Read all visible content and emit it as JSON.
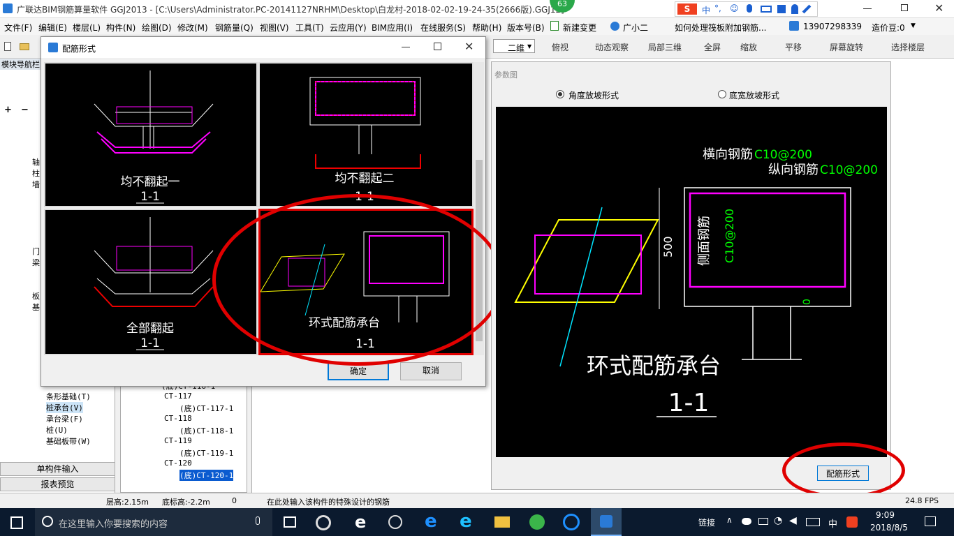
{
  "app": {
    "title": "广联达BIM钢筋算量软件 GGJ2013 - [C:\\Users\\Administrator.PC-20141127NRHM\\Desktop\\白龙村-2018-02-02-19-24-35(2666版).GGJ12]",
    "badge": "63"
  },
  "ime_bar": [
    "中",
    "°,",
    "☺",
    "🎤",
    "⌨",
    "👕",
    "👤",
    "🔧"
  ],
  "menu": [
    "文件(F)",
    "编辑(E)",
    "楼层(L)",
    "构件(N)",
    "绘图(D)",
    "修改(M)",
    "钢筋量(Q)",
    "视图(V)",
    "工具(T)",
    "云应用(Y)",
    "BIM应用(I)",
    "在线服务(S)",
    "帮助(H)",
    "版本号(B)",
    "新建变更",
    "广小二",
    "如何处理筏板附加钢筋...",
    "13907298339",
    "造价豆:0"
  ],
  "toolbar": {
    "view_mode": "二维",
    "items": [
      "俯视",
      "动态观察",
      "局部三维",
      "全屏",
      "缩放",
      "平移",
      "屏幕旋转",
      "选择楼层"
    ]
  },
  "left_panel": {
    "title": "模块导航栏",
    "tree": [
      "轴",
      "柱",
      "墙",
      "门",
      "梁",
      "板",
      "基"
    ],
    "items": [
      "条形基础(T)",
      "桩承台(V)",
      "承台梁(F)",
      "桩(U)",
      "基础板带(W)"
    ],
    "bottom_buttons": [
      "单构件输入",
      "报表预览"
    ]
  },
  "component_tree": [
    {
      "label": "(底)CT-116-1",
      "level": 2
    },
    {
      "label": "CT-117",
      "level": 1
    },
    {
      "label": "(底)CT-117-1",
      "level": 2
    },
    {
      "label": "CT-118",
      "level": 1
    },
    {
      "label": "(底)CT-118-1",
      "level": 2
    },
    {
      "label": "CT-119",
      "level": 1
    },
    {
      "label": "(底)CT-119-1",
      "level": 2
    },
    {
      "label": "CT-120",
      "level": 1
    },
    {
      "label": "(底)CT-120-1",
      "level": 2
    }
  ],
  "dialog": {
    "title": "配筋形式",
    "options": [
      {
        "name": "均不翻起一",
        "section": "1-1"
      },
      {
        "name": "均不翻起二",
        "section": "1-1"
      },
      {
        "name": "全部翻起",
        "section": "1-1"
      },
      {
        "name": "环式配筋承台",
        "section": "1-1"
      }
    ],
    "selected": "环式配筋承台",
    "ok_label": "确定",
    "cancel_label": "取消"
  },
  "param_panel": {
    "title": "参数图",
    "radio_angle": "角度放坡形式",
    "radio_width": "底宽放坡形式",
    "diagram": {
      "transverse": "横向钢筋",
      "transverse_val": "C10@200",
      "longitudinal": "纵向钢筋",
      "longitudinal_val": "C10@200",
      "side": "侧面钢筋",
      "side_val": "C10@200",
      "height": "500",
      "zero": "0",
      "name": "环式配筋承台",
      "section": "1-1"
    },
    "button": "配筋形式"
  },
  "status": {
    "floor_height": "层高:2.15m",
    "bottom_elev": "底标高:-2.2m",
    "value": "0",
    "hint": "在此处输入该构件的特殊设计的钢筋",
    "fps": "24.8 FPS"
  },
  "taskbar": {
    "search_placeholder": "在这里输入你要搜索的内容",
    "link": "链接",
    "lang": "中",
    "time": "9:09",
    "date": "2018/8/5"
  },
  "colors": {
    "highlight": "#e00000",
    "magenta": "#ff00ff",
    "green": "#00ff00",
    "yellow": "#ffff00",
    "cyan": "#00e5ff"
  }
}
